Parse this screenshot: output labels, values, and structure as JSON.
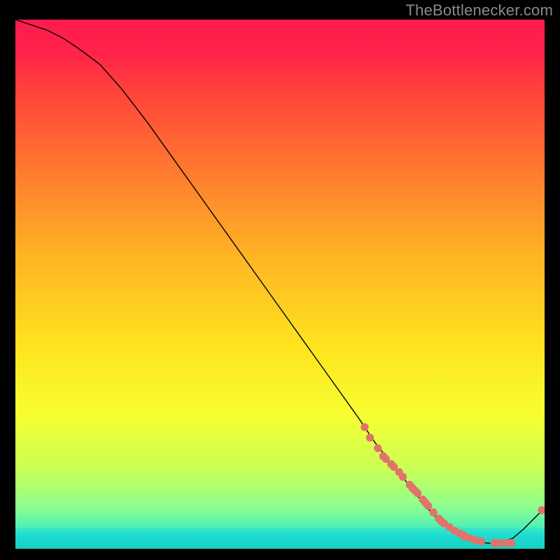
{
  "watermark": "TheBottlenecker.com",
  "gradient_stops": [
    {
      "offset": 0.0,
      "color": "#ff1a4f"
    },
    {
      "offset": 0.06,
      "color": "#ff2249"
    },
    {
      "offset": 0.15,
      "color": "#ff4839"
    },
    {
      "offset": 0.3,
      "color": "#ff7f2e"
    },
    {
      "offset": 0.45,
      "color": "#ffb524"
    },
    {
      "offset": 0.62,
      "color": "#ffe41f"
    },
    {
      "offset": 0.75,
      "color": "#f6ff32"
    },
    {
      "offset": 0.85,
      "color": "#c8ff55"
    },
    {
      "offset": 0.92,
      "color": "#8eff8e"
    },
    {
      "offset": 0.958,
      "color": "#53f0b3"
    },
    {
      "offset": 0.962,
      "color": "#36e7c5"
    },
    {
      "offset": 0.975,
      "color": "#1fdbd3"
    },
    {
      "offset": 1.0,
      "color": "#16cfbf"
    }
  ],
  "chart_data": {
    "type": "line",
    "title": "",
    "xlabel": "",
    "ylabel": "",
    "xlim": [
      0,
      100
    ],
    "ylim": [
      0,
      100
    ],
    "grid": false,
    "legend": false,
    "series": [
      {
        "name": "curve",
        "x": [
          0,
          3,
          6,
          9,
          12,
          16,
          20,
          25,
          30,
          35,
          40,
          45,
          50,
          55,
          60,
          65,
          68,
          70,
          72,
          74,
          76,
          78,
          80,
          82,
          84,
          86,
          88,
          90,
          92,
          94,
          96,
          98,
          100
        ],
        "y": [
          100,
          99,
          98,
          96.5,
          94.5,
          91.5,
          87,
          80.5,
          73.5,
          66.5,
          59.5,
          52.5,
          45.5,
          38.5,
          31.5,
          24.5,
          20,
          17.5,
          15,
          12.5,
          10,
          7.5,
          5.5,
          4,
          2.8,
          1.8,
          1.2,
          1.0,
          1.2,
          2.0,
          3.7,
          5.7,
          7.7
        ]
      }
    ],
    "points": {
      "name": "markers",
      "color": "#e2736b",
      "x": [
        66,
        67,
        68.5,
        69.5,
        70,
        71,
        71.5,
        72.5,
        73.2,
        74.5,
        75,
        75.5,
        76,
        77,
        77.5,
        78,
        79,
        80,
        80.5,
        81,
        82,
        83,
        84,
        84.5,
        85,
        86,
        87,
        88,
        90.5,
        91.5,
        92.8,
        93.7,
        99.5
      ],
      "y": [
        23,
        21,
        19,
        17.5,
        17,
        16,
        15.5,
        14.5,
        13.6,
        12.1,
        11.5,
        11,
        10.5,
        9.3,
        8.7,
        8.1,
        6.9,
        5.7,
        5.2,
        4.8,
        4.1,
        3.4,
        2.9,
        2.6,
        2.3,
        2.0,
        1.6,
        1.4,
        1.1,
        1.1,
        1.1,
        1.1,
        7.3
      ]
    }
  }
}
